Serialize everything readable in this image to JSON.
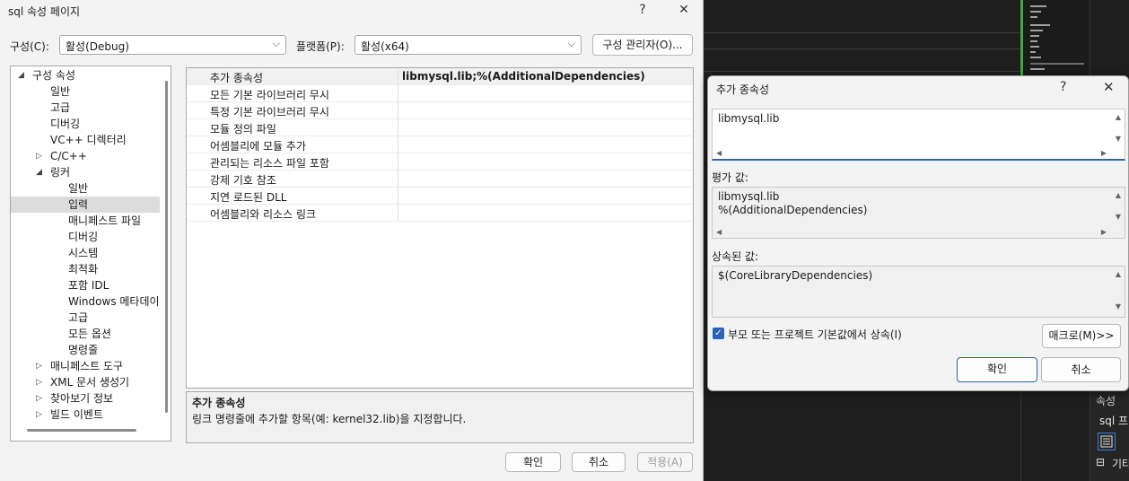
{
  "dialog": {
    "title": "sql 속성 페이지",
    "help_glyph": "?",
    "close_glyph": "✕",
    "config_label": "구성(C):",
    "config_value": "활성(Debug)",
    "platform_label": "플랫폼(P):",
    "platform_value": "활성(x64)",
    "config_manager_button": "구성 관리자(O)...",
    "ok_button": "확인",
    "cancel_button": "취소",
    "apply_button": "적용(A)"
  },
  "tree": {
    "items": [
      {
        "label": "구성 속성",
        "expander": "◢"
      },
      {
        "label": "일반",
        "expander": ""
      },
      {
        "label": "고급",
        "expander": ""
      },
      {
        "label": "디버깅",
        "expander": ""
      },
      {
        "label": "VC++ 디렉터리",
        "expander": ""
      },
      {
        "label": "C/C++",
        "expander": "▷"
      },
      {
        "label": "링커",
        "expander": "◢"
      },
      {
        "label": "일반",
        "expander": ""
      },
      {
        "label": "입력",
        "expander": ""
      },
      {
        "label": "매니페스트 파일",
        "expander": ""
      },
      {
        "label": "디버깅",
        "expander": ""
      },
      {
        "label": "시스템",
        "expander": ""
      },
      {
        "label": "최적화",
        "expander": ""
      },
      {
        "label": "포함 IDL",
        "expander": ""
      },
      {
        "label": "Windows 메타데이",
        "expander": ""
      },
      {
        "label": "고급",
        "expander": ""
      },
      {
        "label": "모든 옵션",
        "expander": ""
      },
      {
        "label": "명령줄",
        "expander": ""
      },
      {
        "label": "매니페스트 도구",
        "expander": "▷"
      },
      {
        "label": "XML 문서 생성기",
        "expander": "▷"
      },
      {
        "label": "찾아보기 정보",
        "expander": "▷"
      },
      {
        "label": "빌드 이벤트",
        "expander": "▷"
      }
    ],
    "selected_label": "입력"
  },
  "grid": {
    "rows": [
      {
        "key": "추가 종속성",
        "value": "libmysql.lib;%(AdditionalDependencies)"
      },
      {
        "key": "모든 기본 라이브러리 무시",
        "value": ""
      },
      {
        "key": "특정 기본 라이브러리 무시",
        "value": ""
      },
      {
        "key": "모듈 정의 파일",
        "value": ""
      },
      {
        "key": "어셈블리에 모듈 추가",
        "value": ""
      },
      {
        "key": "관리되는 리소스 파일 포함",
        "value": ""
      },
      {
        "key": "강제 기호 참조",
        "value": ""
      },
      {
        "key": "지연 로드된 DLL",
        "value": ""
      },
      {
        "key": "어셈블리와 리소스 링크",
        "value": ""
      }
    ]
  },
  "description": {
    "title": "추가 종속성",
    "text": "링크 명령줄에 추가할 항목(예: kernel32.lib)을 지정합니다."
  },
  "popup": {
    "title": "추가 종속성",
    "help_glyph": "?",
    "close_glyph": "✕",
    "edit_value": "libmysql.lib",
    "evaluated_label": "평가 값:",
    "evaluated_value": "libmysql.lib\n%(AdditionalDependencies)",
    "inherited_label": "상속된 값:",
    "inherited_value": "$(CoreLibraryDependencies)",
    "inherit_checkbox_label": "부모 또는 프로젝트 기본값에서 상속(I)",
    "inherit_checked": true,
    "macros_button": "매크로(M)>>",
    "ok_button": "확인",
    "cancel_button": "취소"
  },
  "ide": {
    "panel_title": "속성",
    "panel_item": "sql 프",
    "panel_group": "기타",
    "panel_group_glyph": "⊟"
  }
}
